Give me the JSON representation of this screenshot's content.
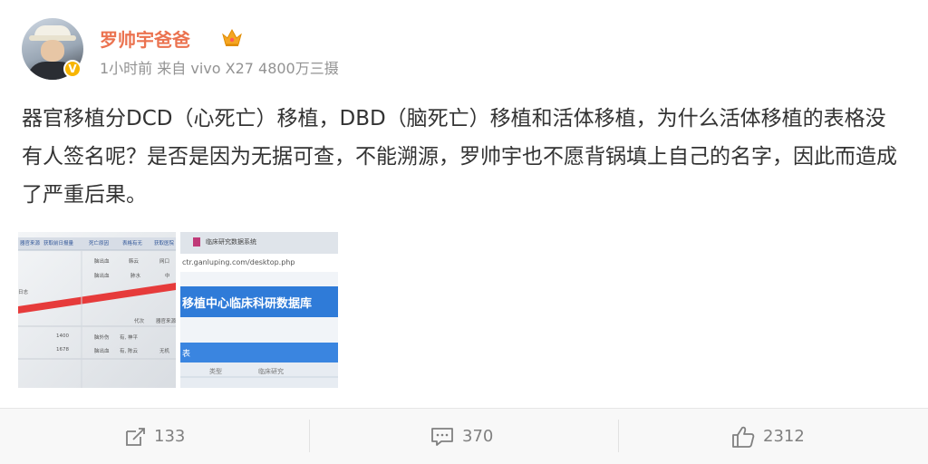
{
  "post": {
    "author": "罗帅宇爸爸",
    "verified_badge": "V",
    "meta": "1小时前 来自 vivo X27 4800万三摄",
    "text": "器官移植分DCD（心死亡）移植，DBD（脑死亡）移植和活体移植，为什么活体移植的表格没有人签名呢？是否是因为无据可查，不能溯源，罗帅宇也不愿背锅填上自己的名字，因此而造成了严重后果。"
  },
  "images": {
    "image1": {
      "headers": [
        "器官来源",
        "获取前日报量",
        "死亡原因",
        "表格有无",
        "获取医院"
      ],
      "row_a": [
        "脑出血",
        "韩云",
        "网口"
      ],
      "row_b": [
        "脑出血",
        "肺水",
        "中"
      ],
      "col_labels": [
        "代次",
        "器官来源"
      ],
      "row1": [
        "1400",
        "脑外伤",
        "有, 神平"
      ],
      "row2": [
        "1678",
        "脑出血",
        "有, 陈云",
        "无机"
      ],
      "side_text": "日志"
    },
    "image2": {
      "tab_title": "临床研究数据系统",
      "url": "ctr.ganluping.com/desktop.php",
      "banner": "移植中心临床科研数据库",
      "footer_left": "表",
      "footer_cells": [
        "类型",
        "临床研究"
      ]
    }
  },
  "actions": {
    "repost_count": "133",
    "comment_count": "370",
    "like_count": "2312"
  },
  "colors": {
    "username": "#eb7350",
    "verified": "#f7b500",
    "meta": "#939393"
  }
}
